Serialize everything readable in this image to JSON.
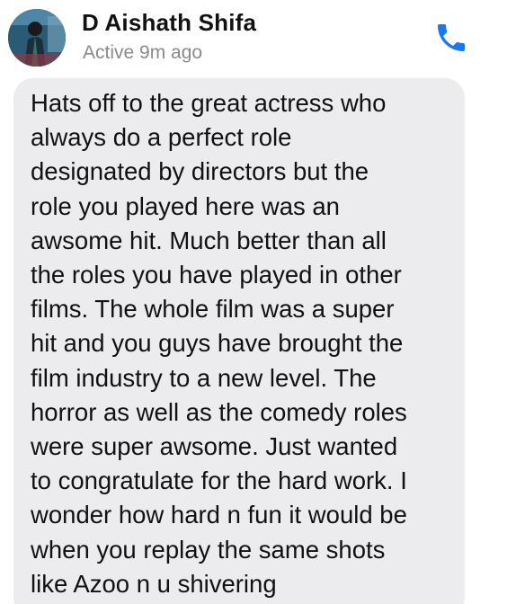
{
  "header": {
    "contact_name": "D Aishath Shifa",
    "active_status": "Active 9m ago",
    "call_icon": "phone-icon"
  },
  "message": {
    "text": "Hats off to the great actress who\nalways do a perfect role\ndesignated by directors but the\nrole you played here was an\nawsome hit. Much better than all\nthe roles you  have played in other\nfilms. The whole film was a super\nhit and you guys have brought the\nfilm industry to a new level. The\nhorror as well as the comedy roles\nwere super awsome. Just wanted\nto congratulate for the hard work. I\nwonder how hard n fun it would be\nwhen you replay the same shots\nlike Azoo n u shivering"
  },
  "colors": {
    "accent": "#1877f2",
    "bubble": "#ececee",
    "secondary_text": "#8a8a8a"
  }
}
